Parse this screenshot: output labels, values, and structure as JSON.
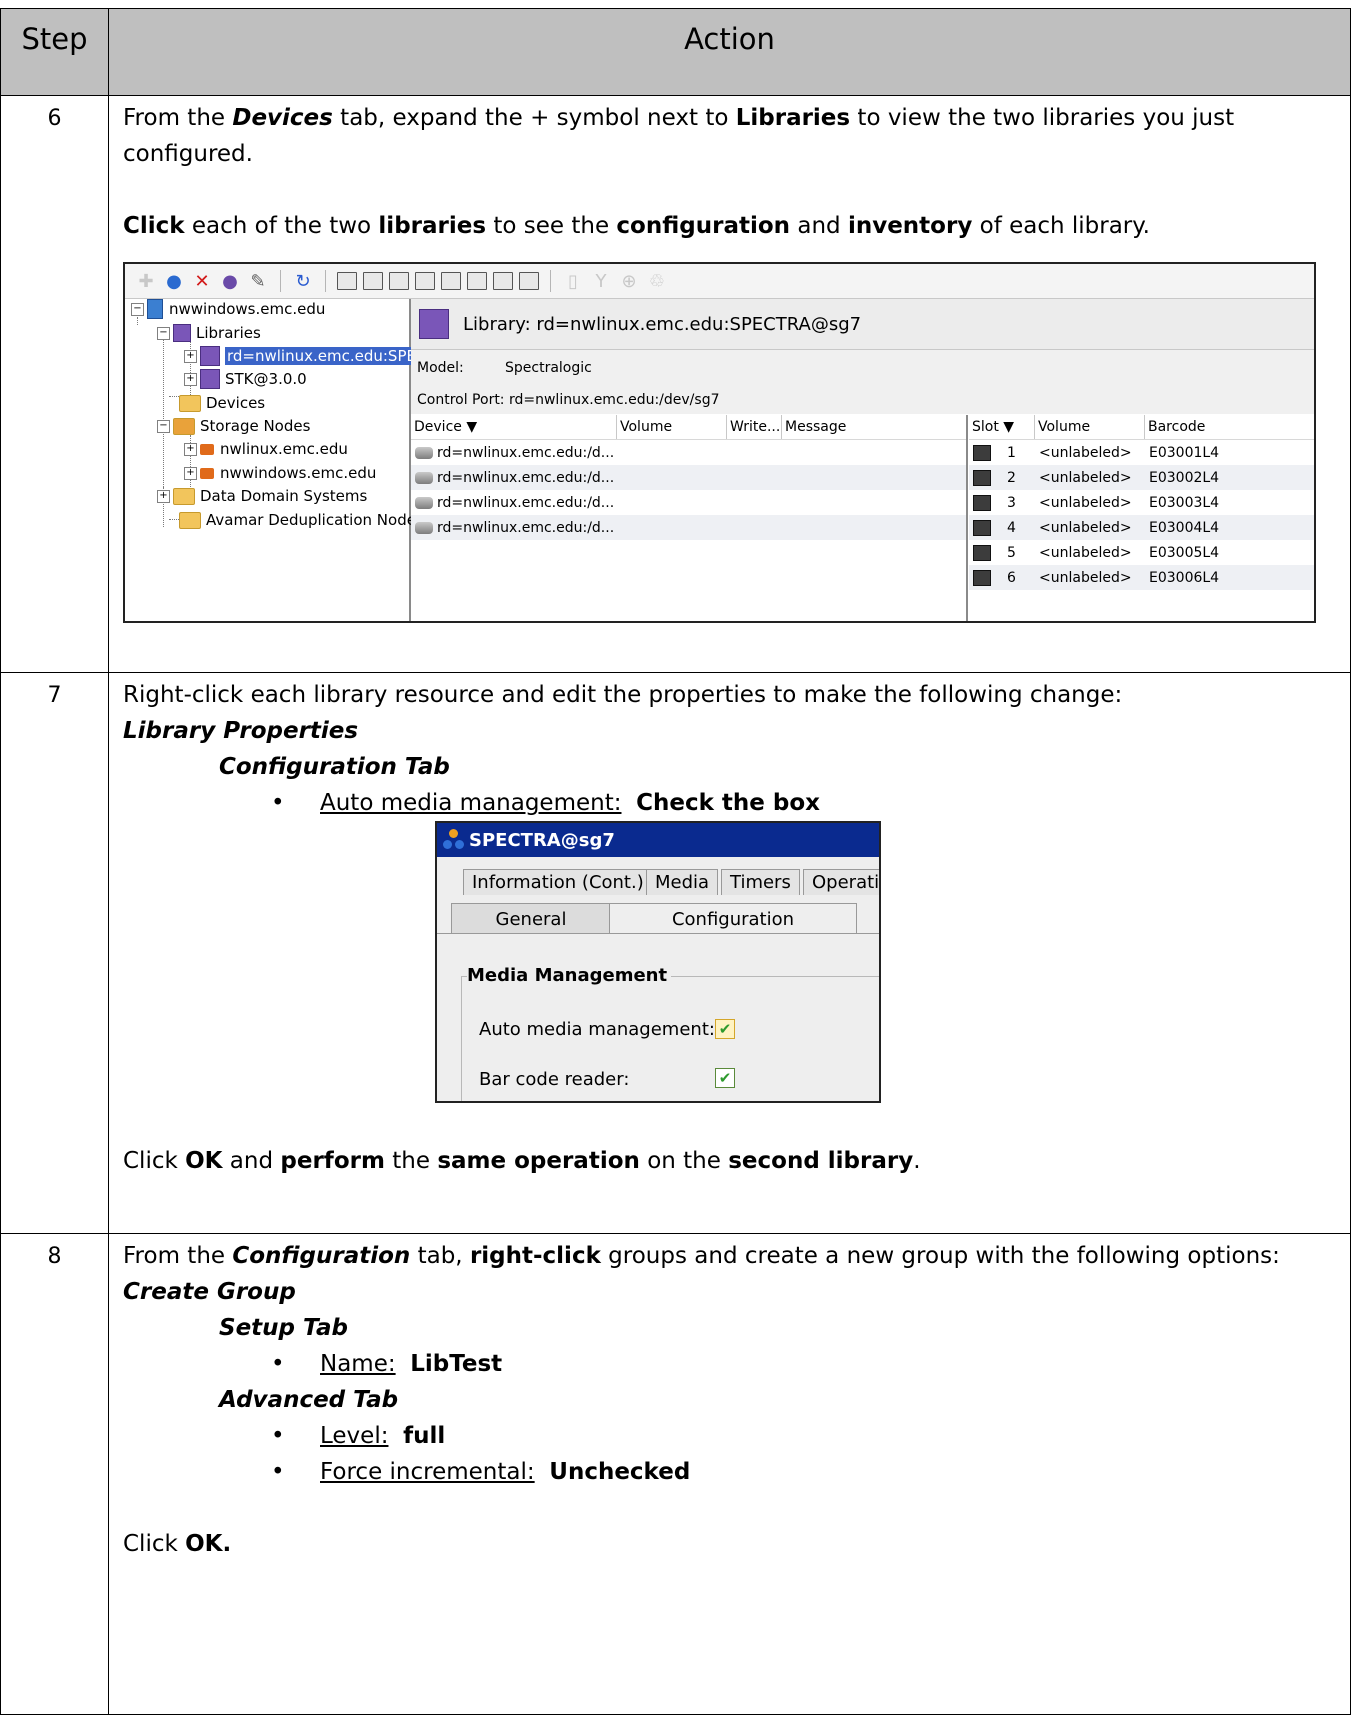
{
  "table": {
    "header_step": "Step",
    "header_action": "Action"
  },
  "step6": {
    "number": "6",
    "l1a": "From the ",
    "l1b": "Devices",
    "l1c": " tab, expand the + symbol next to ",
    "l1d": "Libraries",
    "l1e": " to view the two libraries you just",
    "l2": "configured.",
    "l3a": "Click",
    "l3b": " each of the two ",
    "l3c": "libraries",
    "l3d": " to see the ",
    "l3e": "configuration",
    "l3f": " and ",
    "l3g": "inventory",
    "l3h": " of each library."
  },
  "shot1": {
    "tree": {
      "root": "nwwindows.emc.edu",
      "libraries": "Libraries",
      "lib1": "rd=nwlinux.emc.edu:SPE(",
      "lib2": "STK@3.0.0",
      "devices": "Devices",
      "storage_nodes": "Storage Nodes",
      "sn1": "nwlinux.emc.edu",
      "sn2": "nwwindows.emc.edu",
      "ddsys": "Data Domain Systems",
      "avamar": "Avamar Deduplication Nodes"
    },
    "header": "Library: rd=nwlinux.emc.edu:SPECTRA@sg7",
    "model_label": "Model:",
    "model_value": "Spectralogic",
    "control_port": "Control Port:  rd=nwlinux.emc.edu:/dev/sg7",
    "device_columns": [
      "Device  ▼",
      "Volume",
      "Write...",
      "Message"
    ],
    "devices": [
      "rd=nwlinux.emc.edu:/d...",
      "rd=nwlinux.emc.edu:/d...",
      "rd=nwlinux.emc.edu:/d...",
      "rd=nwlinux.emc.edu:/d..."
    ],
    "slot_columns": [
      "Slot  ▼",
      "Volume",
      "Barcode"
    ],
    "slots": [
      {
        "slot": "1",
        "volume": "<unlabeled>",
        "barcode": "E03001L4"
      },
      {
        "slot": "2",
        "volume": "<unlabeled>",
        "barcode": "E03002L4"
      },
      {
        "slot": "3",
        "volume": "<unlabeled>",
        "barcode": "E03003L4"
      },
      {
        "slot": "4",
        "volume": "<unlabeled>",
        "barcode": "E03004L4"
      },
      {
        "slot": "5",
        "volume": "<unlabeled>",
        "barcode": "E03005L4"
      },
      {
        "slot": "6",
        "volume": "<unlabeled>",
        "barcode": "E03006L4"
      }
    ]
  },
  "step7": {
    "number": "7",
    "l1": "Right-click each library resource and edit the properties to make the following change:",
    "l2": "Library Properties",
    "l3": "Configuration Tab",
    "bullet_label": "Auto media management:",
    "bullet_value": "Check the box",
    "l_ok_a": "Click ",
    "l_ok_b": "OK",
    "l_ok_c": " and ",
    "l_ok_d": "perform",
    "l_ok_e": " the ",
    "l_ok_f": "same operation",
    "l_ok_g": " on the ",
    "l_ok_h": "second library",
    "l_ok_i": "."
  },
  "shot2": {
    "title": "SPECTRA@sg7",
    "tabs_row1": [
      "Information (Cont.)",
      "Media",
      "Timers",
      "Operatio"
    ],
    "tab_general": "General",
    "tab_configuration": "Configuration",
    "group_title": "Media Management",
    "opt1": "Auto media management:",
    "opt2": "Bar code reader:",
    "check": "✔"
  },
  "step8": {
    "number": "8",
    "l1a": "From the ",
    "l1b": "Configuration",
    "l1c": " tab, ",
    "l1d": "right-click",
    "l1e": " groups and create a new group with the following options:",
    "l2": "Create Group",
    "l3": "Setup Tab",
    "b1_label": "Name:",
    "b1_value": "LibTest",
    "l4": "Advanced Tab",
    "b2_label": "Level:",
    "b2_value": "full",
    "b3_label": "Force incremental:",
    "b3_value": "Unchecked",
    "ok_a": "Click ",
    "ok_b": "OK."
  }
}
